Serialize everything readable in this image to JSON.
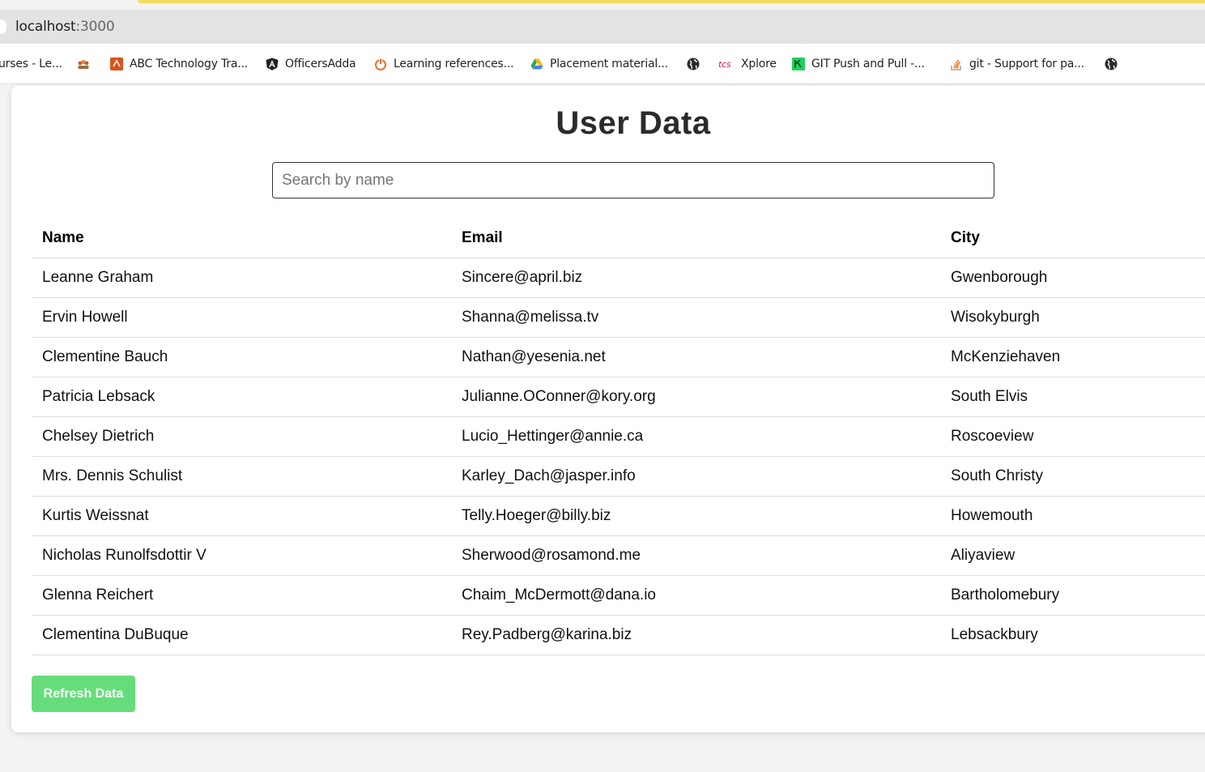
{
  "browser": {
    "url_host": "localhost",
    "url_port": ":3000",
    "bookmarks": [
      {
        "label": "urses - Le...",
        "icon": "none"
      },
      {
        "label": "",
        "icon": "group-people-icon"
      },
      {
        "label": "ABC Technology Tra...",
        "icon": "orange-logo-icon"
      },
      {
        "label": "OfficersAdda",
        "icon": "angular-logo-icon"
      },
      {
        "label": "Learning references...",
        "icon": "power-icon"
      },
      {
        "label": "Placement material...",
        "icon": "google-drive-icon"
      },
      {
        "label": "",
        "icon": "globe-icon"
      },
      {
        "label": "Xplore",
        "icon": "tcs-logo-icon"
      },
      {
        "label": "GIT Push and Pull -...",
        "icon": "green-code-icon"
      },
      {
        "label": "git - Support for pa...",
        "icon": "stack-overflow-icon"
      },
      {
        "label": "",
        "icon": "globe-icon"
      }
    ]
  },
  "page": {
    "title": "User Data",
    "search_placeholder": "Search by name",
    "table": {
      "headers": [
        "Name",
        "Email",
        "City"
      ],
      "rows": [
        [
          "Leanne Graham",
          "Sincere@april.biz",
          "Gwenborough"
        ],
        [
          "Ervin Howell",
          "Shanna@melissa.tv",
          "Wisokyburgh"
        ],
        [
          "Clementine Bauch",
          "Nathan@yesenia.net",
          "McKenziehaven"
        ],
        [
          "Patricia Lebsack",
          "Julianne.OConner@kory.org",
          "South Elvis"
        ],
        [
          "Chelsey Dietrich",
          "Lucio_Hettinger@annie.ca",
          "Roscoeview"
        ],
        [
          "Mrs. Dennis Schulist",
          "Karley_Dach@jasper.info",
          "South Christy"
        ],
        [
          "Kurtis Weissnat",
          "Telly.Hoeger@billy.biz",
          "Howemouth"
        ],
        [
          "Nicholas Runolfsdottir V",
          "Sherwood@rosamond.me",
          "Aliyaview"
        ],
        [
          "Glenna Reichert",
          "Chaim_McDermott@dana.io",
          "Bartholomebury"
        ],
        [
          "Clementina DuBuque",
          "Rey.Padberg@karina.biz",
          "Lebsackbury"
        ]
      ]
    },
    "refresh_label": "Refresh Data"
  },
  "colors": {
    "refresh_button": "#66dd7a",
    "tab_accent": "#f5dc62"
  }
}
